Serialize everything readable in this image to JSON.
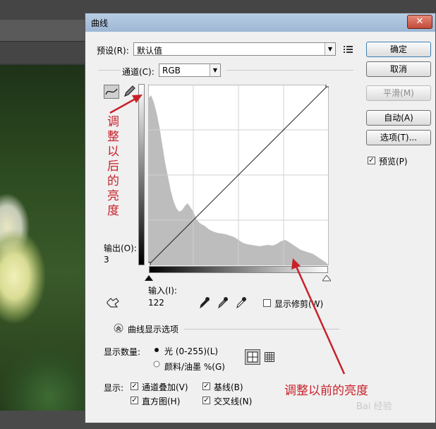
{
  "dialog": {
    "title": "曲线",
    "close_label": "✕",
    "preset_label": "预设(R):",
    "preset_value": "默认值",
    "channel_label": "通道(C):",
    "channel_value": "RGB",
    "output_label": "输出(O):",
    "output_value": "3",
    "input_label": "输入(I):",
    "input_value": "122",
    "show_clipping_label": "显示修剪(W)",
    "curve_options_label": "曲线显示选项",
    "show_amount_label": "显示数量:",
    "light_label": "光 (0-255)(L)",
    "pigment_label": "颜料/油墨 %(G)",
    "show_label": "显示:",
    "channel_overlays_label": "通道叠加(V)",
    "baseline_label": "基线(B)",
    "histogram_label": "直方图(H)",
    "intersection_label": "交叉线(N)",
    "preview_label": "预览(P)"
  },
  "buttons": {
    "ok": "确定",
    "cancel": "取消",
    "smooth": "平滑(M)",
    "auto": "自动(A)",
    "options": "选项(T)..."
  },
  "annotations": {
    "after": "调整以后的亮度",
    "before": "调整以前的亮度"
  },
  "watermark": "Bai 经验",
  "colors": {
    "annotation": "#c8212a",
    "histogram": "#bdbdbd",
    "titlebar": "#a9c2dd"
  }
}
